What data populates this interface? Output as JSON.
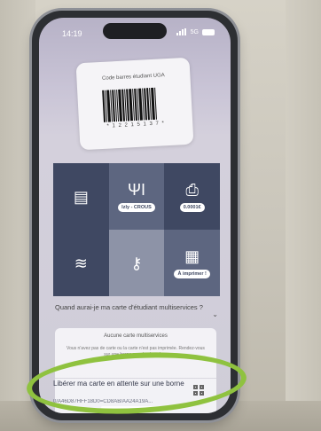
{
  "status": {
    "time": "14:19",
    "network": "5G"
  },
  "card": {
    "title": "Code barres étudiant UGA",
    "number": "* 1 2 2 1 5 1 3 7 *"
  },
  "tiles": [
    {
      "icon": "card-icon",
      "label": ""
    },
    {
      "icon": "fork-knife-icon",
      "label": "Izly - CROUS"
    },
    {
      "icon": "printer-icon",
      "label": "0.0001€"
    },
    {
      "icon": "swimmer-icon",
      "label": ""
    },
    {
      "icon": "key-lock-icon",
      "label": ""
    },
    {
      "icon": "print-job-icon",
      "label": "À imprimer !"
    }
  ],
  "faq": {
    "question": "Quand aurai-je ma carte d'étudiant multiservices ?"
  },
  "sheet": {
    "title": "Aucune carte multiservices",
    "text": "Vous n'avez pas de carte ou la carte n'est pas imprimée. Rendez-vous sur une borne pour la récupérer."
  },
  "cta": {
    "label": "Libérer ma carte en attente sur une borne",
    "code": "0/A46D87HFF18D0=CD8AB/AA24A19A..."
  },
  "annotation_color": "#8fc23f"
}
